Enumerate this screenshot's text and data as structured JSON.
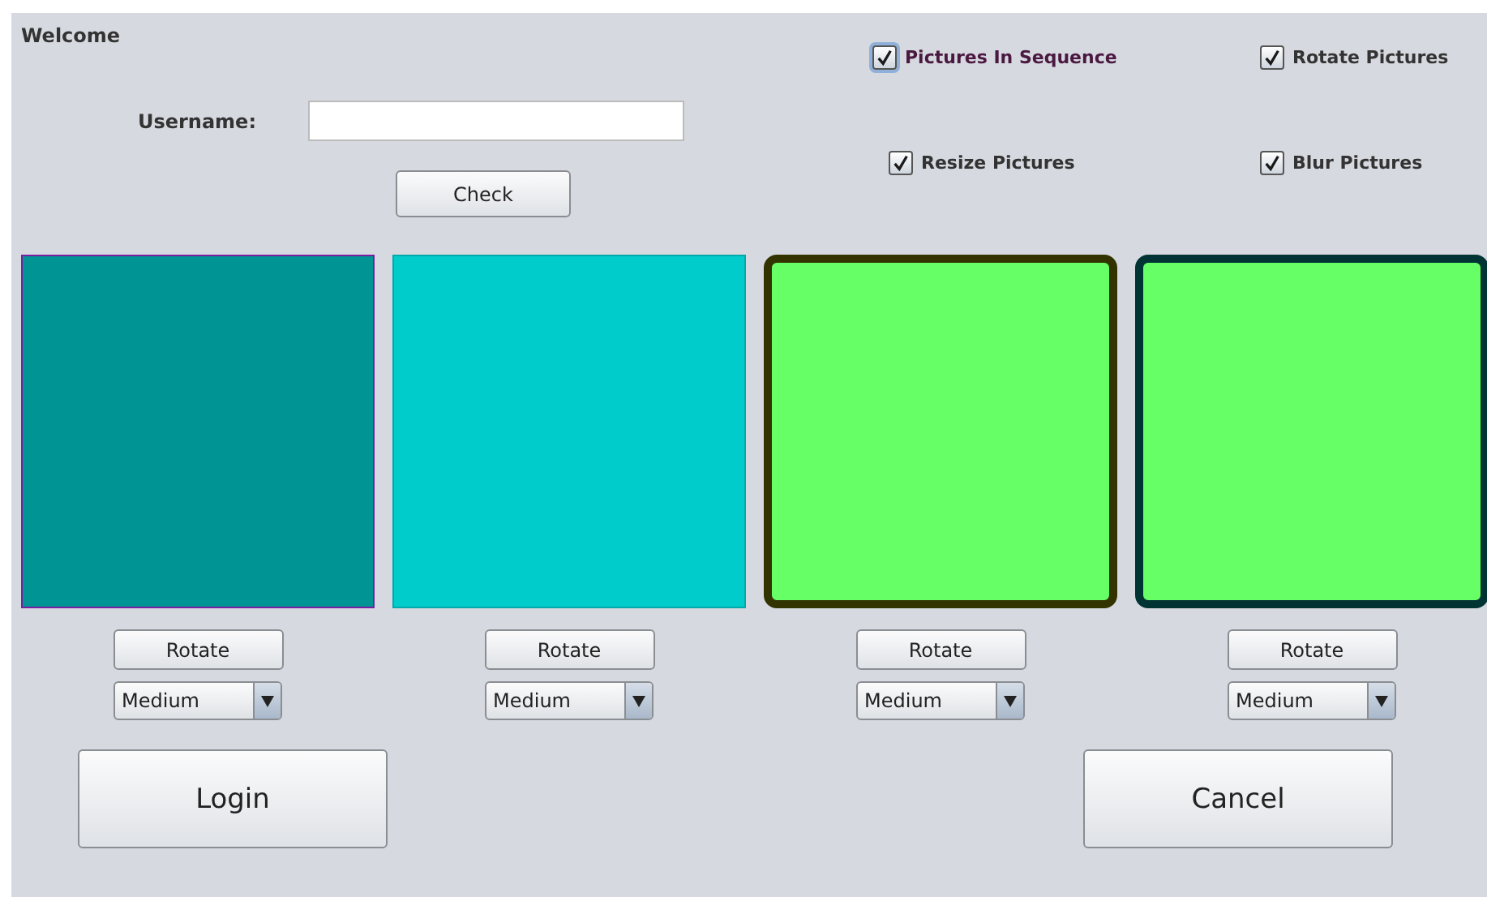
{
  "heading": "Welcome",
  "username": {
    "label": "Username:"
  },
  "check_button": "Check",
  "options": [
    {
      "label": "Pictures In Sequence",
      "checked": true,
      "focused": true
    },
    {
      "label": "Rotate Pictures",
      "checked": true,
      "focused": false
    },
    {
      "label": "Resize Pictures",
      "checked": true,
      "focused": false
    },
    {
      "label": "Blur Pictures",
      "checked": true,
      "focused": false
    }
  ],
  "tiles": [
    {
      "kind": "flat",
      "color": "#009494",
      "frame": {
        "color": "#7a1fa2"
      },
      "button": "Rotate",
      "size": "Medium"
    },
    {
      "kind": "flat",
      "color": "#00cccc",
      "frame": {
        "color": "#00aaaa"
      },
      "button": "Rotate",
      "size": "Medium"
    },
    {
      "kind": "framed",
      "color": "#66ff66",
      "frame": {
        "color": "#333300"
      },
      "button": "Rotate",
      "size": "Medium"
    },
    {
      "kind": "framed",
      "color": "#66ff66",
      "frame": {
        "color": "#003333"
      },
      "button": "Rotate",
      "size": "Medium"
    }
  ],
  "buttons": [
    "Login",
    "Cancel"
  ]
}
